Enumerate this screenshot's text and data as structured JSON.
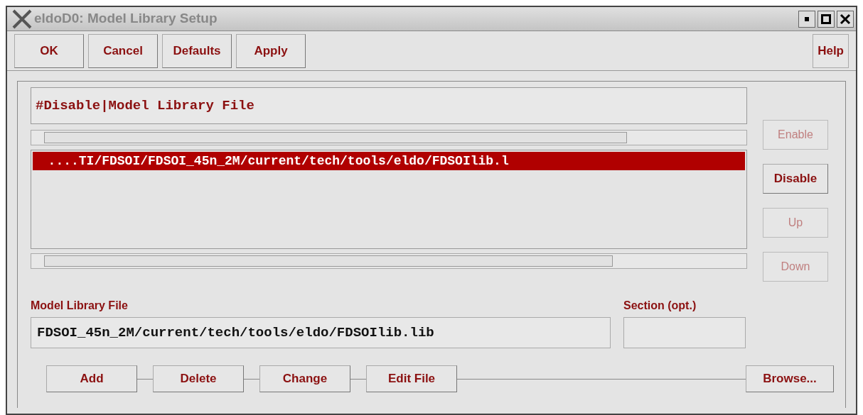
{
  "window": {
    "title": "eldoD0: Model Library Setup"
  },
  "toolbar": {
    "buttons": [
      "OK",
      "Cancel",
      "Defaults",
      "Apply"
    ],
    "help": "Help"
  },
  "list": {
    "header": "#Disable|Model Library File",
    "rows": [
      {
        "text": "  ....TI/FDSOI/FDSOI_45n_2M/current/tech/tools/eldo/FDSOIlib.l",
        "selected": true
      }
    ]
  },
  "side_buttons": [
    {
      "label": "Enable",
      "disabled": true
    },
    {
      "label": "Disable",
      "disabled": false
    },
    {
      "label": "Up",
      "disabled": true
    },
    {
      "label": "Down",
      "disabled": true
    }
  ],
  "fields": [
    {
      "label": "Model Library File",
      "value": "FDSOI_45n_2M/current/tech/tools/eldo/FDSOIlib.lib"
    },
    {
      "label": "Section (opt.)"
    }
  ],
  "bottom_buttons": [
    "Add",
    "Delete",
    "Change",
    "Edit File"
  ],
  "browse": "Browse..."
}
